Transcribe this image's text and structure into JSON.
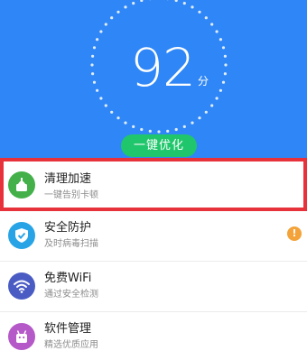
{
  "header": {
    "score": "92",
    "unit": "分",
    "optimize_button": "一键优化",
    "background_color": "#2f86f6"
  },
  "items": [
    {
      "title": "清理加速",
      "subtitle": "一键告别卡顿",
      "icon": "broom-icon",
      "icon_color": "#43b04a",
      "highlighted": true
    },
    {
      "title": "安全防护",
      "subtitle": "及时病毒扫描",
      "icon": "shield-icon",
      "icon_color": "#28a4e6",
      "badge": "!",
      "badge_color": "#f3a33a"
    },
    {
      "title": "免费WiFi",
      "subtitle": "通过安全检测",
      "icon": "wifi-icon",
      "icon_color": "#4a5cc4"
    },
    {
      "title": "软件管理",
      "subtitle": "精选优质应用",
      "icon": "robot-icon",
      "icon_color": "#b558c8"
    }
  ]
}
